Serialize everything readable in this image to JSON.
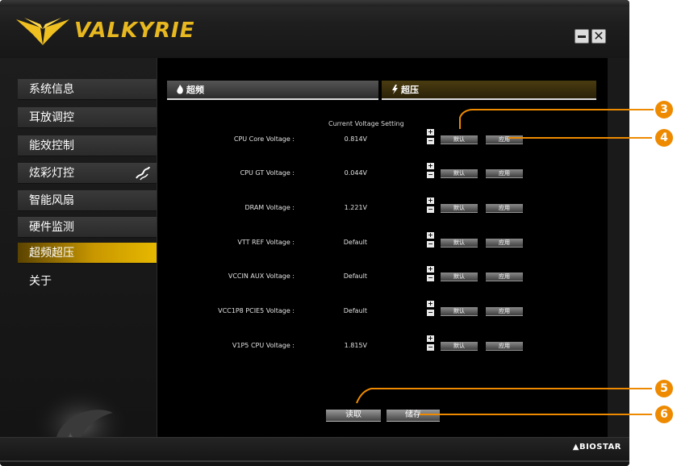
{
  "app": {
    "logo_text": "VALKYRIE",
    "minimize_label": "",
    "close_glyph": "✕",
    "brand_footer": "▲BIOSTAR",
    "accent_color": "#e6b800",
    "callout_color": "#ee8a00"
  },
  "sidebar": {
    "items": [
      {
        "label": "系统信息"
      },
      {
        "label": "耳放调控"
      },
      {
        "label": "能效控制"
      },
      {
        "label": "炫彩灯控"
      },
      {
        "label": "智能风扇"
      },
      {
        "label": "硬件监测"
      },
      {
        "label": "超频超压"
      },
      {
        "label": "关于"
      }
    ],
    "active_index": 6
  },
  "tabs": [
    {
      "label": "超频",
      "icon": "flame-icon"
    },
    {
      "label": "超压",
      "icon": "spark-icon"
    }
  ],
  "table": {
    "headers": {
      "current": "Current Voltage",
      "setting": "Setting"
    },
    "rows": [
      {
        "label": "CPU Core Voltage :",
        "value": "0.814V"
      },
      {
        "label": "CPU GT Voltage :",
        "value": "0.044V"
      },
      {
        "label": "DRAM Voltage :",
        "value": "1.221V"
      },
      {
        "label": "VTT REF Voltage :",
        "value": "Default"
      },
      {
        "label": "VCCIN AUX Voltage :",
        "value": "Default"
      },
      {
        "label": "VCC1P8 PCIE5 Voltage :",
        "value": "Default"
      },
      {
        "label": "V1P5 CPU Voltage :",
        "value": "1.815V"
      }
    ],
    "plus": "+",
    "minus": "−",
    "default_label": "默认",
    "apply_label": "应用"
  },
  "actions": {
    "read_label": "读取",
    "save_label": "储存"
  },
  "callouts": [
    "3",
    "4",
    "5",
    "6"
  ]
}
